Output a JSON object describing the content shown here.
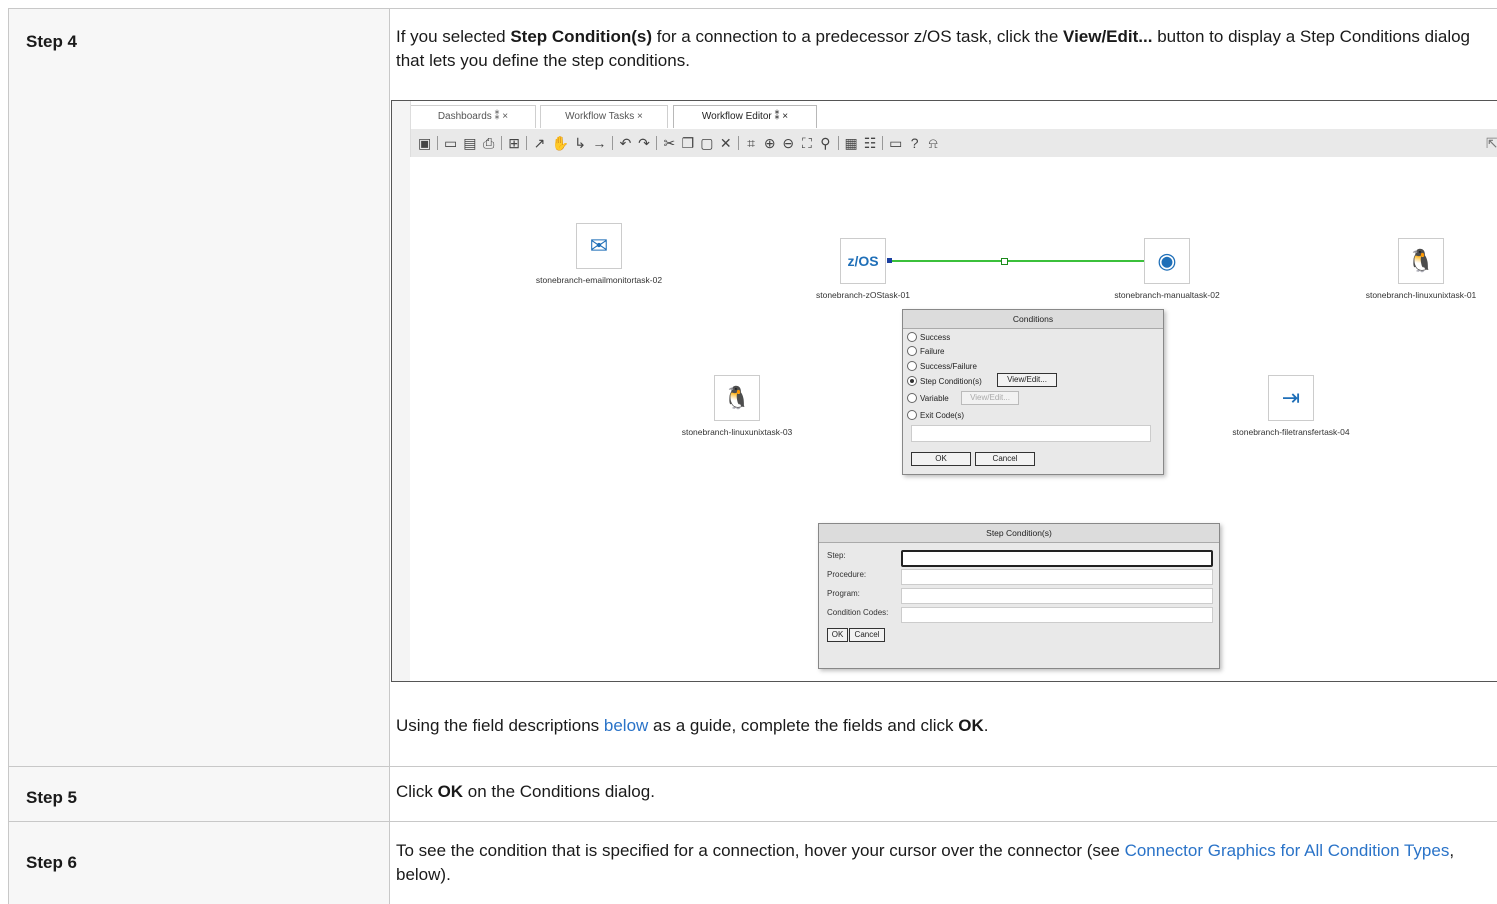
{
  "rows": [
    {
      "label": "Step 4"
    },
    {
      "label": "Step 5"
    },
    {
      "label": "Step 6"
    }
  ],
  "step4": {
    "p1_a": "If you selected ",
    "p1_b": "Step Condition(s)",
    "p1_c": " for a connection to a predecessor z/OS task, click the ",
    "p1_d": "View/Edit...",
    "p1_e": " button to display a Step Conditions dialog that lets you define the step conditions.",
    "p2_a": "Using the field descriptions ",
    "p2_link": "below",
    "p2_b": " as a guide, complete the fields and click ",
    "p2_c": "OK",
    "p2_d": "."
  },
  "step5": {
    "a": "Click ",
    "b": "OK",
    "c": " on the Conditions dialog."
  },
  "step6": {
    "a": "To see the condition that is specified for a connection, hover your cursor over the connector (see ",
    "link": "Connector Graphics for All Condition Types",
    "b": ", below)."
  },
  "screenshot": {
    "tabs": [
      "Dashboards ⁑ ×",
      "Workflow Tasks ×",
      "Workflow Editor ⁑ ×"
    ],
    "nodes": [
      {
        "label": "stonebranch-emailmonitortask-02",
        "icon": "email-monitor-icon"
      },
      {
        "label": "stonebranch-zOStask-01",
        "icon": "zos-icon",
        "glyph": "z/OS"
      },
      {
        "label": "stonebranch-manualtask-02",
        "icon": "manual-task-icon"
      },
      {
        "label": "stonebranch-linuxunixtask-01",
        "icon": "linux-icon"
      },
      {
        "label": "stonebranch-linuxunixtask-03",
        "icon": "linux-icon"
      },
      {
        "label": "stonebranch-filetransfertask-04",
        "icon": "file-transfer-icon"
      }
    ],
    "conditions_dialog": {
      "title": "Conditions",
      "options": [
        "Success",
        "Failure",
        "Success/Failure",
        "Step Condition(s)",
        "Variable",
        "Exit Code(s)"
      ],
      "selected": "Step Condition(s)",
      "view_edit": "View/Edit...",
      "ok": "OK",
      "cancel": "Cancel"
    },
    "step_dialog": {
      "title": "Step Condition(s)",
      "fields": [
        "Step:",
        "Procedure:",
        "Program:",
        "Condition Codes:"
      ],
      "ok": "OK",
      "cancel": "Cancel"
    }
  }
}
